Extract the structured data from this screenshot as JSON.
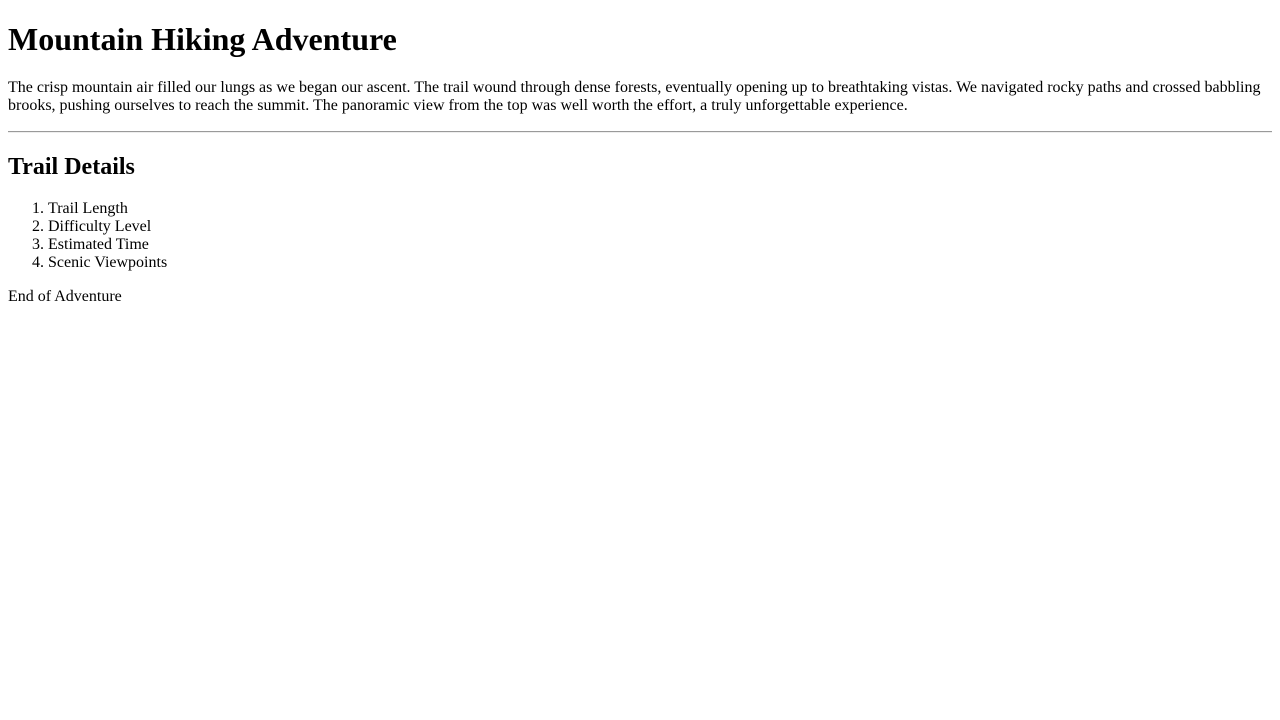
{
  "document": {
    "title": "Mountain Hiking Adventure",
    "intro": "The crisp mountain air filled our lungs as we began our ascent. The trail wound through dense forests, eventually opening up to breathtaking vistas. We navigated rocky paths and crossed babbling brooks, pushing ourselves to reach the summit. The panoramic view from the top was well worth the effort, a truly unforgettable experience.",
    "section_heading": "Trail Details",
    "details": [
      "Trail Length",
      "Difficulty Level",
      "Estimated Time",
      "Scenic Viewpoints"
    ],
    "footer": "End of Adventure"
  }
}
